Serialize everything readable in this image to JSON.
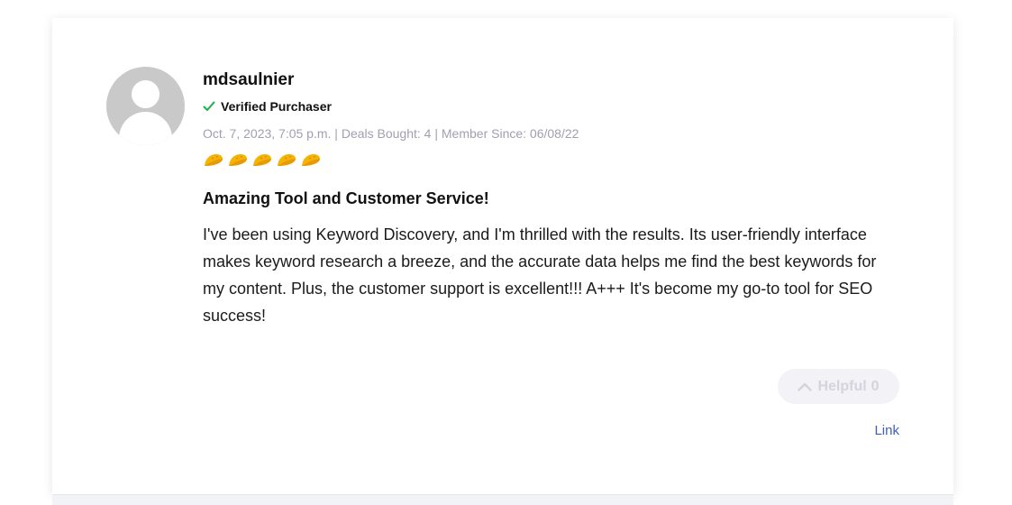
{
  "review": {
    "username": "mdsaulnier",
    "verified_label": "Verified Purchaser",
    "date": "Oct. 7, 2023, 7:05 p.m.",
    "deals_bought": "Deals Bought: 4",
    "member_since": "Member Since: 06/08/22",
    "meta_separator": " | ",
    "rating": 5,
    "rating_max": 5,
    "title": "Amazing Tool and Customer Service!",
    "body": "I've been using Keyword Discovery, and I'm thrilled with the results. Its user-friendly interface makes keyword research a breeze, and the accurate data helps me find the best keywords for my content. Plus, the customer support is excellent!!! A+++ It's become my go-to tool for SEO success!",
    "helpful_label": "Helpful",
    "helpful_count": "0",
    "link_label": "Link"
  },
  "colors": {
    "verified_check": "#1ab04a",
    "taco": "#f4b400",
    "meta_text": "#a09fb2",
    "link": "#3f5fbd",
    "helpful_bg": "#f2f2f7",
    "helpful_text": "#d4d4dc"
  },
  "icons": {
    "verified": "check-icon",
    "rating": "taco-icon",
    "helpful": "chevron-up-icon"
  }
}
